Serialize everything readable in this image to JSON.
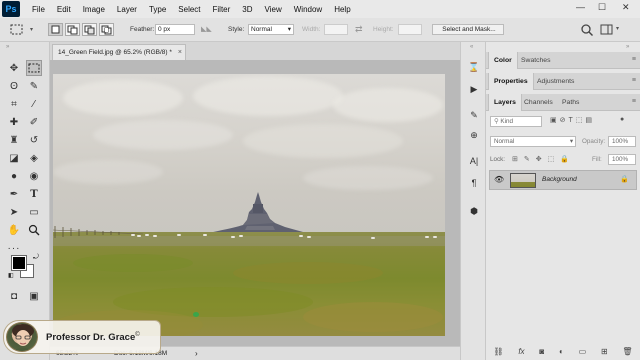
{
  "app": {
    "logo": "Ps"
  },
  "menu": [
    "File",
    "Edit",
    "Image",
    "Layer",
    "Type",
    "Select",
    "Filter",
    "3D",
    "View",
    "Window",
    "Help"
  ],
  "window_controls": {
    "minimize": "—",
    "maximize": "☐",
    "close": "✕"
  },
  "options": {
    "feather_label": "Feather:",
    "feather_value": "0 px",
    "style_label": "Style:",
    "style_value": "Normal",
    "width_label": "Width:",
    "height_label": "Height:",
    "select_mask": "Select and Mask...",
    "swap": "⇄"
  },
  "document": {
    "tab_title": "14_Green Field.jpg @ 65.2% (RGB/8) *",
    "close": "×"
  },
  "status": {
    "zoom": "65.22%",
    "doc": "Doc: 6.18M/6.18M",
    "arrow": "›"
  },
  "presenter": {
    "name": "Professor Dr. Grace",
    "mark": "©"
  },
  "panels": {
    "top_tabs": [
      "Color",
      "Swatches"
    ],
    "mid_tabs": [
      "Properties",
      "Adjustments"
    ],
    "layer_tabs": [
      "Layers",
      "Channels",
      "Paths"
    ],
    "kind_placeholder": "Kind",
    "blend_mode": "Normal",
    "opacity_label": "Opacity:",
    "opacity_value": "100%",
    "lock_label": "Lock:",
    "fill_label": "Fill:",
    "fill_value": "100%",
    "layer_name": "Background",
    "footer_icons": [
      "link-icon",
      "fx-icon",
      "mask-icon",
      "adjustment-icon",
      "group-icon",
      "new-layer-icon",
      "trash-icon"
    ]
  },
  "colors": {
    "fg": "#000000",
    "bg": "#ffffff",
    "accent": "#31a8ff"
  }
}
